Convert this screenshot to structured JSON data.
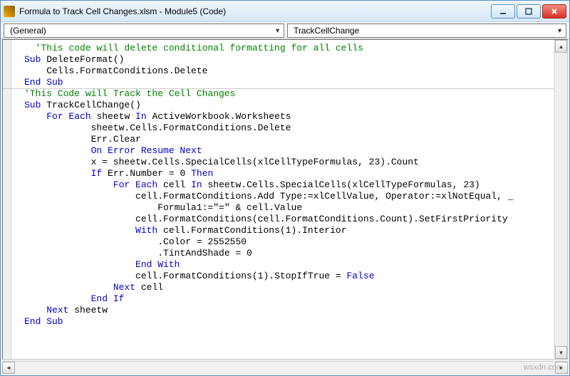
{
  "window": {
    "title": "Formula to Track Cell Changes.xlsm - Module5 (Code)"
  },
  "dropdowns": {
    "object": "(General)",
    "procedure": "TrackCellChange"
  },
  "code": {
    "lines": [
      {
        "i": 2,
        "cls": "c-comment",
        "t": "'This code will delete conditional formatting for all cells"
      },
      {
        "i": 0,
        "segs": [
          {
            "cls": "c-kw",
            "t": "Sub "
          },
          {
            "cls": "c-text",
            "t": "DeleteFormat()"
          }
        ]
      },
      {
        "i": 4,
        "cls": "c-text",
        "t": "Cells.FormatConditions.Delete"
      },
      {
        "i": 0,
        "cls": "c-kw",
        "t": "End Sub"
      },
      {
        "i": 0,
        "cls": "c-comment",
        "t": "'This Code will Track the Cell Changes"
      },
      {
        "i": 0,
        "segs": [
          {
            "cls": "c-kw",
            "t": "Sub "
          },
          {
            "cls": "c-text",
            "t": "TrackCellChange()"
          }
        ]
      },
      {
        "i": 4,
        "segs": [
          {
            "cls": "c-kw",
            "t": "For Each "
          },
          {
            "cls": "c-text",
            "t": "sheetw "
          },
          {
            "cls": "c-kw",
            "t": "In "
          },
          {
            "cls": "c-text",
            "t": "ActiveWorkbook.Worksheets"
          }
        ]
      },
      {
        "i": 12,
        "cls": "c-text",
        "t": "sheetw.Cells.FormatConditions.Delete"
      },
      {
        "i": 12,
        "cls": "c-text",
        "t": "Err.Clear"
      },
      {
        "i": 12,
        "cls": "c-kw",
        "t": "On Error Resume Next"
      },
      {
        "i": 12,
        "cls": "c-text",
        "t": "x = sheetw.Cells.SpecialCells(xlCellTypeFormulas, 23).Count"
      },
      {
        "i": 12,
        "segs": [
          {
            "cls": "c-kw",
            "t": "If "
          },
          {
            "cls": "c-text",
            "t": "Err.Number = 0 "
          },
          {
            "cls": "c-kw",
            "t": "Then"
          }
        ]
      },
      {
        "i": 16,
        "segs": [
          {
            "cls": "c-kw",
            "t": "For Each "
          },
          {
            "cls": "c-text",
            "t": "cell "
          },
          {
            "cls": "c-kw",
            "t": "In "
          },
          {
            "cls": "c-text",
            "t": "sheetw.Cells.SpecialCells(xlCellTypeFormulas, 23)"
          }
        ]
      },
      {
        "i": 20,
        "cls": "c-text",
        "t": "cell.FormatConditions.Add Type:=xlCellValue, Operator:=xlNotEqual, _"
      },
      {
        "i": 24,
        "cls": "c-text",
        "t": "Formula1:=\"=\" & cell.Value"
      },
      {
        "i": 20,
        "cls": "c-text",
        "t": "cell.FormatConditions(cell.FormatConditions.Count).SetFirstPriority"
      },
      {
        "i": 20,
        "segs": [
          {
            "cls": "c-kw",
            "t": "With "
          },
          {
            "cls": "c-text",
            "t": "cell.FormatConditions(1).Interior"
          }
        ]
      },
      {
        "i": 24,
        "cls": "c-text",
        "t": ".Color = 2552550"
      },
      {
        "i": 24,
        "cls": "c-text",
        "t": ".TintAndShade = 0"
      },
      {
        "i": 20,
        "cls": "c-kw",
        "t": "End With"
      },
      {
        "i": 20,
        "segs": [
          {
            "cls": "c-text",
            "t": "cell.FormatConditions(1).StopIfTrue = "
          },
          {
            "cls": "c-kw",
            "t": "False"
          }
        ]
      },
      {
        "i": 16,
        "segs": [
          {
            "cls": "c-kw",
            "t": "Next "
          },
          {
            "cls": "c-text",
            "t": "cell"
          }
        ]
      },
      {
        "i": 12,
        "cls": "c-kw",
        "t": "End If"
      },
      {
        "i": 0,
        "cls": "c-text",
        "t": ""
      },
      {
        "i": 4,
        "segs": [
          {
            "cls": "c-kw",
            "t": "Next "
          },
          {
            "cls": "c-text",
            "t": "sheetw"
          }
        ]
      },
      {
        "i": 0,
        "cls": "c-kw",
        "t": "End Sub"
      }
    ]
  },
  "watermark": "wsxdn.com"
}
